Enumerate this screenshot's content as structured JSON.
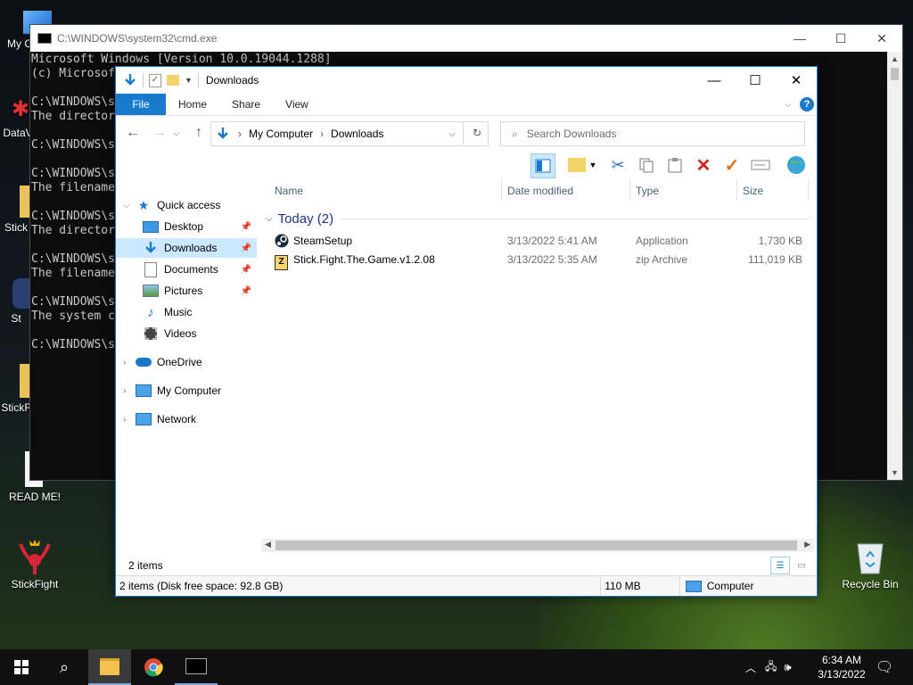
{
  "desktop": {
    "icons": [
      {
        "label": "My C",
        "name": "my-computer-desktop-icon"
      },
      {
        "label": "DataV",
        "name": "datav-desktop-icon"
      },
      {
        "label": "Stick",
        "name": "stick-folder-desktop-icon"
      },
      {
        "label": "St",
        "name": "st-shortcut-desktop-icon"
      },
      {
        "label": "StickF",
        "name": "stickf-folder-desktop-icon"
      },
      {
        "label": "READ ME!",
        "name": "readme-desktop-icon"
      },
      {
        "label": "StickFight",
        "name": "stickfight-desktop-icon"
      },
      {
        "label": "Recycle Bin",
        "name": "recycle-bin-desktop-icon"
      }
    ]
  },
  "cmd": {
    "title": "C:\\WINDOWS\\system32\\cmd.exe",
    "lines": [
      "Microsoft Windows [Version 10.0.19044.1288]",
      "(c) Microsof",
      "",
      "C:\\WINDOWS\\s",
      "The director",
      "",
      "C:\\WINDOWS\\s",
      "",
      "C:\\WINDOWS\\s",
      "The filename",
      "",
      "C:\\WINDOWS\\s",
      "The director",
      "",
      "C:\\WINDOWS\\s",
      "The filename",
      "",
      "C:\\WINDOWS\\s",
      "The system c",
      "",
      "C:\\WINDOWS\\s"
    ]
  },
  "explorer": {
    "title": "Downloads",
    "ribbon": {
      "file": "File",
      "home": "Home",
      "share": "Share",
      "view": "View"
    },
    "breadcrumb": [
      "My Computer",
      "Downloads"
    ],
    "search_placeholder": "Search Downloads",
    "tree": [
      {
        "label": "Quick access",
        "icon": "star-icon"
      },
      {
        "label": "Desktop",
        "icon": "desktop-icon",
        "pinned": true
      },
      {
        "label": "Downloads",
        "icon": "download-arrow-icon",
        "pinned": true,
        "selected": true
      },
      {
        "label": "Documents",
        "icon": "documents-icon",
        "pinned": true
      },
      {
        "label": "Pictures",
        "icon": "pictures-icon",
        "pinned": true
      },
      {
        "label": "Music",
        "icon": "music-icon"
      },
      {
        "label": "Videos",
        "icon": "videos-icon"
      },
      {
        "label": "OneDrive",
        "icon": "cloud-icon"
      },
      {
        "label": "My Computer",
        "icon": "computer-icon"
      },
      {
        "label": "Network",
        "icon": "network-icon"
      }
    ],
    "columns": {
      "name": "Name",
      "date": "Date modified",
      "type": "Type",
      "size": "Size"
    },
    "group": "Today (2)",
    "files": [
      {
        "name": "SteamSetup",
        "date": "3/13/2022 5:41 AM",
        "type": "Application",
        "size": "1,730 KB",
        "icon": "steam-icon"
      },
      {
        "name": "Stick.Fight.The.Game.v1.2.08",
        "date": "3/13/2022 5:35 AM",
        "type": "zip Archive",
        "size": "111,019 KB",
        "icon": "zip-archive-icon"
      }
    ],
    "status_count": "2 items",
    "details": {
      "disk": "2 items (Disk free space: 92.8 GB)",
      "size": "110 MB",
      "location": "Computer"
    }
  },
  "taskbar": {
    "time": "6:34 AM",
    "date": "3/13/2022"
  }
}
